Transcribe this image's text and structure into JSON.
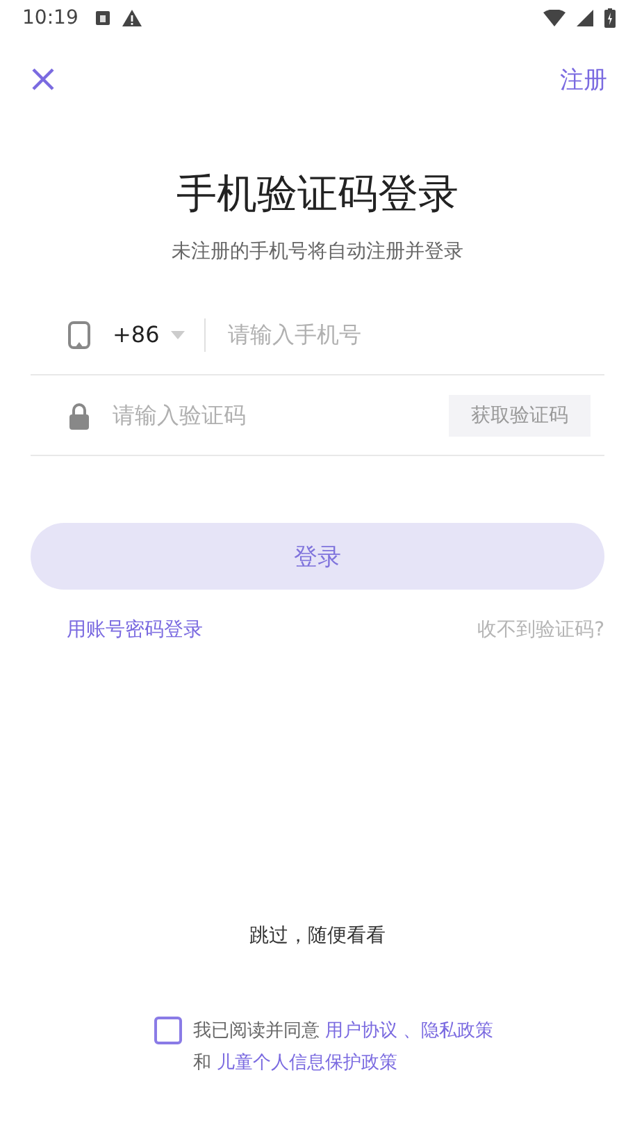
{
  "status_bar": {
    "time": "10:19"
  },
  "header": {
    "register": "注册"
  },
  "title": "手机验证码登录",
  "subtitle": "未注册的手机号将自动注册并登录",
  "phone": {
    "country_code": "+86",
    "placeholder": "请输入手机号"
  },
  "code": {
    "placeholder": "请输入验证码",
    "get_code": "获取验证码"
  },
  "login_button": {
    "label": "登录",
    "disabled": true
  },
  "links": {
    "password_login": "用账号密码登录",
    "no_code": "收不到验证码?"
  },
  "skip": "跳过，随便看看",
  "agreement": {
    "checked": false,
    "prefix": "我已阅读并同意",
    "links": [
      "用户协议",
      "、隐私政策"
    ],
    "and": "和",
    "last_link": "儿童个人信息保护政策"
  }
}
